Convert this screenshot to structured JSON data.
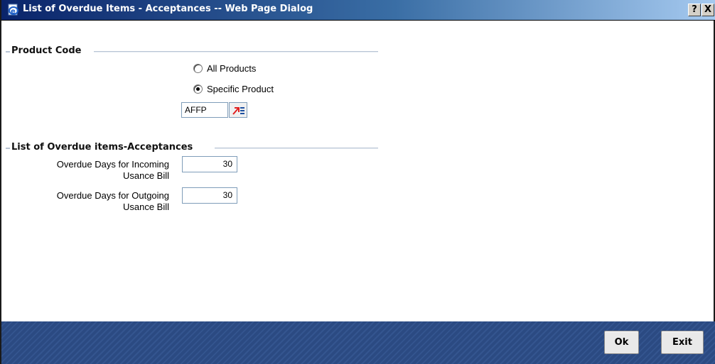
{
  "window": {
    "title": "List of Overdue Items - Acceptances -- Web Page Dialog",
    "help_label": "?",
    "close_label": "X"
  },
  "product_code": {
    "legend": "Product Code",
    "options": [
      {
        "label": "All Products",
        "checked": false
      },
      {
        "label": "Specific Product",
        "checked": true
      }
    ],
    "product_value": "AFFP"
  },
  "overdue_section": {
    "legend": "List of Overdue items-Acceptances",
    "incoming_label_line1": "Overdue Days for Incoming",
    "incoming_label_line2": "Usance Bill",
    "incoming_value": "30",
    "outgoing_label_line1": "Overdue Days for Outgoing",
    "outgoing_label_line2": "Usance Bill",
    "outgoing_value": "30"
  },
  "footer": {
    "ok_label": "Ok",
    "exit_label": "Exit"
  }
}
